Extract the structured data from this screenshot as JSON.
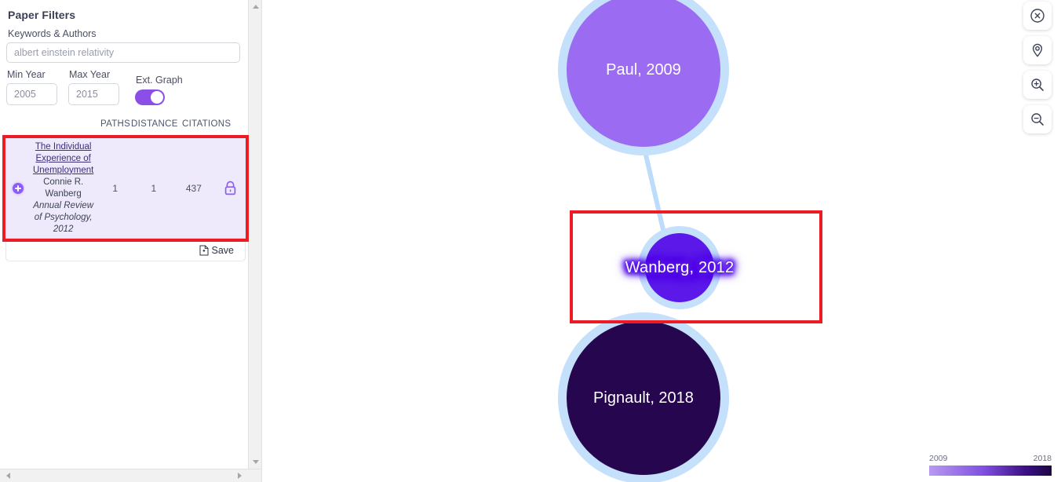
{
  "sidebar": {
    "panel_title": "Paper Filters",
    "keywords_label": "Keywords & Authors",
    "keywords_value": "albert einstein relativity",
    "keywords_placeholder": "albert einstein relativity",
    "min_year_label": "Min Year",
    "min_year_value": "2005",
    "max_year_label": "Max Year",
    "max_year_value": "2015",
    "ext_graph_label": "Ext. Graph",
    "ext_graph_state": "on",
    "columns": {
      "paths": "PATHS",
      "distance": "DISTANCE",
      "citations": "CITATIONS"
    },
    "results": [
      {
        "title": "The Individual Experience of Unemployment",
        "authors": "Connie R. Wanberg",
        "venue": "Annual Review of Psychology, 2012",
        "paths": "1",
        "distance": "1",
        "citations": "437",
        "access_icon": "lock-icon",
        "add_icon": "plus-circle-icon"
      }
    ],
    "save_label": "Save",
    "save_icon": "save-document-icon"
  },
  "graph": {
    "nodes": [
      {
        "id": "paul",
        "label": "Paul, 2009",
        "year": 2009,
        "color": "#9b6bf2",
        "halo": "#c4e0fb",
        "selected": false
      },
      {
        "id": "wanberg",
        "label": "Wanberg, 2012",
        "year": 2012,
        "color": "#5b18e8",
        "halo": "#c4e0fb",
        "selected": true
      },
      {
        "id": "pignault",
        "label": "Pignault, 2018",
        "year": 2018,
        "color": "#26064f",
        "halo": "#c4e0fb",
        "selected": false
      }
    ],
    "edge_color": "#bcdcfb"
  },
  "toolbar": {
    "buttons": [
      {
        "name": "clear-selection-button",
        "icon": "circle-x-icon"
      },
      {
        "name": "locate-button",
        "icon": "map-pin-icon"
      },
      {
        "name": "zoom-in-button",
        "icon": "zoom-in-icon"
      },
      {
        "name": "zoom-out-button",
        "icon": "zoom-out-icon"
      }
    ]
  },
  "legend": {
    "min_label": "2009",
    "max_label": "2018",
    "gradient_from": "#b89af0",
    "gradient_to": "#1d0542"
  },
  "annotations": {
    "highlight_color": "#ed1c24"
  }
}
